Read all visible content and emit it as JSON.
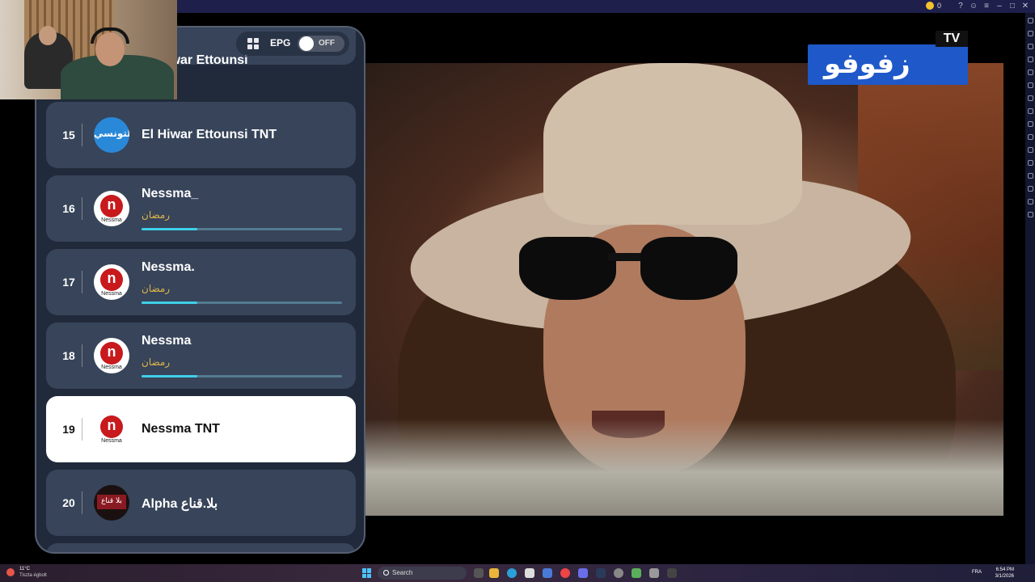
{
  "window": {
    "coins": "0",
    "minimize": "–",
    "maximize": "□",
    "close": "✕"
  },
  "epg": {
    "label": "EPG",
    "toggle_state": "OFF"
  },
  "channels": [
    {
      "number": "",
      "name": "El Hiwar Ettounsi"
    },
    {
      "number": "15",
      "name": "El Hiwar Ettounsi TNT",
      "logo": "التونسي"
    },
    {
      "number": "16",
      "name": "Nessma_",
      "program": "رمضان",
      "progress": 0.28
    },
    {
      "number": "17",
      "name": "Nessma.",
      "program": "رمضان",
      "progress": 0.28
    },
    {
      "number": "18",
      "name": "Nessma",
      "program": "رمضان",
      "progress": 0.28
    },
    {
      "number": "19",
      "name": "Nessma TNT",
      "active": true
    },
    {
      "number": "20",
      "name": "Alpha بلا.قناع",
      "logo": "بلا قناع"
    }
  ],
  "logo_caption": "Nessma",
  "channel_logo": {
    "arabic": "زفوفو",
    "tv": "TV"
  },
  "taskbar": {
    "temperature": "11°C",
    "weather": "Tiszta égbolt",
    "search_label": "Search",
    "language": "FRA",
    "time": "6:54 PM",
    "date": "3/1/2026"
  },
  "colors": {
    "accent": "#3fd0ea",
    "program": "#e0b64b",
    "active_row": "#ffffff"
  }
}
